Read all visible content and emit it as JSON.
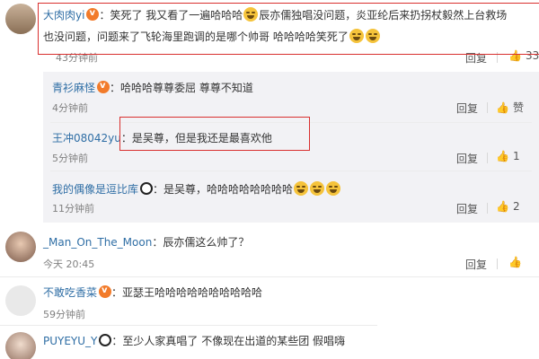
{
  "comments": [
    {
      "user": "大肉肉yi",
      "line1": "：笑死了 我又看了一遍哈哈哈",
      "line1b": "辰亦儒独唱没问题，炎亚纶后来扔拐杖毅然上台救场",
      "line2": "也没问题，问题来了飞轮海里跑调的是哪个帅哥 哈哈哈哈笑死了",
      "time": "43分钟前",
      "reply": "回复",
      "likes": "33"
    },
    {
      "user": "青衫麻怪",
      "text": "：哈哈哈尊尊委屈 尊尊不知道",
      "time": "4分钟前",
      "reply": "回复",
      "likes": "赞"
    },
    {
      "user": "王冲08042yu",
      "text": "：是吴尊，但是我还是最喜欢他",
      "time": "5分钟前",
      "reply": "回复",
      "likes": "1"
    },
    {
      "user": "我的偶像是逗比库",
      "text": "：是吴尊，哈哈哈哈哈哈哈哈",
      "time": "11分钟前",
      "reply": "回复",
      "likes": "2"
    },
    {
      "user": "_Man_On_The_Moon",
      "text": "：辰亦儒这么帅了？",
      "time": "今天 20:45",
      "reply": "回复",
      "likes": ""
    },
    {
      "user": "不敢吃香菜",
      "text": "：亚瑟王哈哈哈哈哈哈哈哈哈哈",
      "time": "59分钟前"
    },
    {
      "user": "PUYEYU_Y",
      "text": "：至少人家真唱了 不像现在出道的某些团 假唱嗨"
    }
  ],
  "colors": {
    "link": "#2f6ea5",
    "highlight": "#d9302f",
    "reply_bg": "#f2f2f5"
  }
}
